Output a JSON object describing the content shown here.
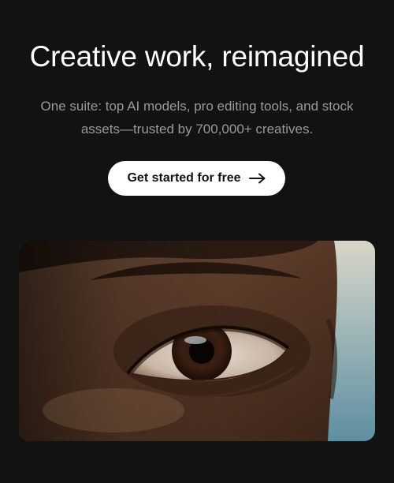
{
  "hero": {
    "headline": "Creative work, reimagined",
    "subcopy": "One suite: top AI models, pro editing tools, and stock assets—trusted by 700,000+ creatives.",
    "cta_label": "Get started for free",
    "cta_icon": "arrow-right-icon"
  },
  "media": {
    "image_subject": "close-up-eye-photo"
  },
  "colors": {
    "background": "#121212",
    "headline": "#ffffff",
    "subcopy": "#9a9a9a",
    "cta_background": "#ffffff",
    "cta_text": "#111111"
  }
}
